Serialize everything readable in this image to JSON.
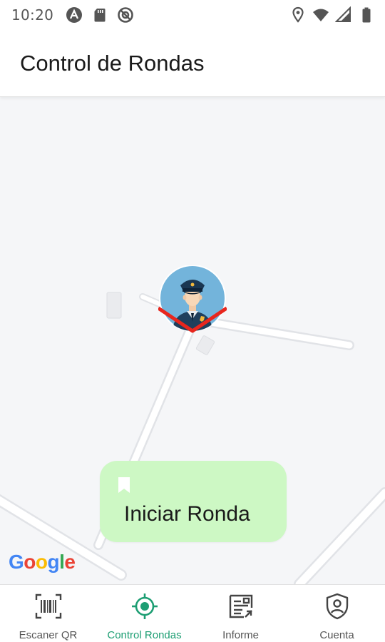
{
  "status_bar": {
    "time": "10:20",
    "left_icons": [
      "android-studio-icon",
      "sd-card-icon",
      "sync-icon"
    ],
    "right_icons": [
      "location-icon",
      "wifi-icon",
      "signal-icon",
      "battery-icon"
    ]
  },
  "app_bar": {
    "title": "Control de Rondas"
  },
  "map": {
    "attribution": [
      "G",
      "o",
      "o",
      "g",
      "l",
      "e"
    ],
    "marker": {
      "icon": "police-officer-avatar",
      "arrow_color": "#e8261d"
    }
  },
  "start_button": {
    "icon": "bookmark-icon",
    "label": "Iniciar Ronda",
    "background": "#cdf8c4"
  },
  "bottom_nav": {
    "items": [
      {
        "label": "Escaner QR",
        "icon": "barcode-scan-icon",
        "active": false
      },
      {
        "label": "Control Rondas",
        "icon": "gps-target-icon",
        "active": true
      },
      {
        "label": "Informe",
        "icon": "report-icon",
        "active": false
      },
      {
        "label": "Cuenta",
        "icon": "account-shield-icon",
        "active": false
      }
    ],
    "active_color": "#1d9e73"
  }
}
